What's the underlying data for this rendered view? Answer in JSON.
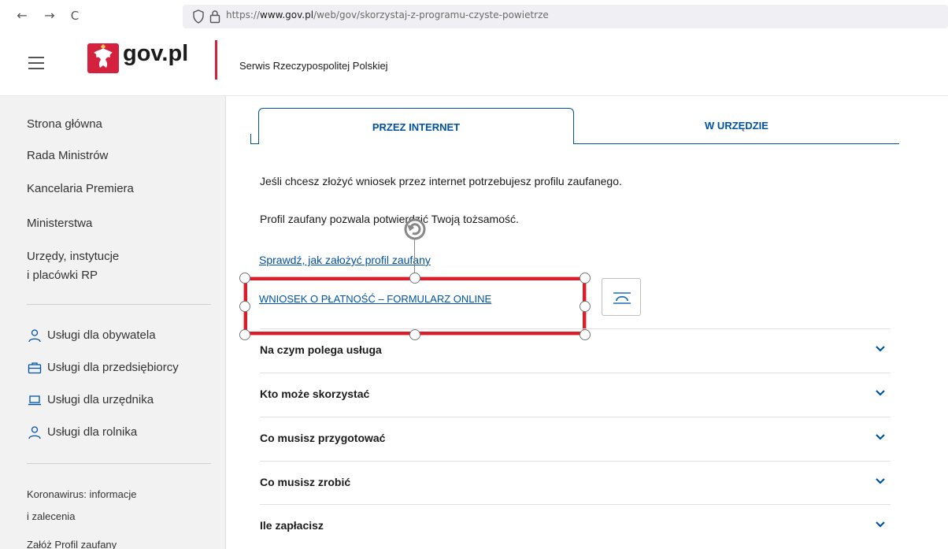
{
  "browser": {
    "back_glyph": "←",
    "forward_glyph": "→",
    "reload_glyph": "C",
    "url_prefix": "https://",
    "url_domain": "www.gov.pl",
    "url_path": "/web/gov/skorzystaj-z-programu-czyste-powietrze"
  },
  "header": {
    "logo_text": "gov.pl",
    "service_name": "Serwis Rzeczypospolitej Polskiej",
    "brand_red": "#d4213d"
  },
  "sidebar": {
    "nav_items": [
      "Strona główna",
      "Rada Ministrów",
      "Kancelaria Premiera",
      "Ministerstwa",
      "Urzędy, instytucje"
    ],
    "nav_item_5_line2": "i placówki RP",
    "services": [
      {
        "label": "Usługi dla obywatela",
        "icon": "person-icon"
      },
      {
        "label": "Usługi dla przedsiębiorcy",
        "icon": "briefcase-icon"
      },
      {
        "label": "Usługi dla urzędnika",
        "icon": "laptop-icon"
      },
      {
        "label": "Usługi dla rolnika",
        "icon": "person-icon"
      }
    ],
    "extra_line1": "Koronawirus: informacje",
    "extra_line2": "i zalecenia",
    "extra_line3": "Załóż Profil zaufany"
  },
  "tabs": {
    "active": "PRZEZ INTERNET",
    "inactive": "W URZĘDZIE",
    "accent": "#0052a5"
  },
  "content": {
    "para1": "Jeśli chcesz złożyć wniosek przez internet potrzebujesz profilu zaufanego.",
    "para2": "Profil zaufany pozwala potwierdzić Twoją tożsamość.",
    "link1": "Sprawdź, jak założyć profil zaufany",
    "link2": "WNIOSEK O PŁATNOŚĆ – FORMULARZ ONLINE"
  },
  "accordion": [
    "Na czym polega usługa",
    "Kto może skorzystać",
    "Co musisz przygotować",
    "Co musisz zrobić",
    "Ile zapłacisz"
  ]
}
